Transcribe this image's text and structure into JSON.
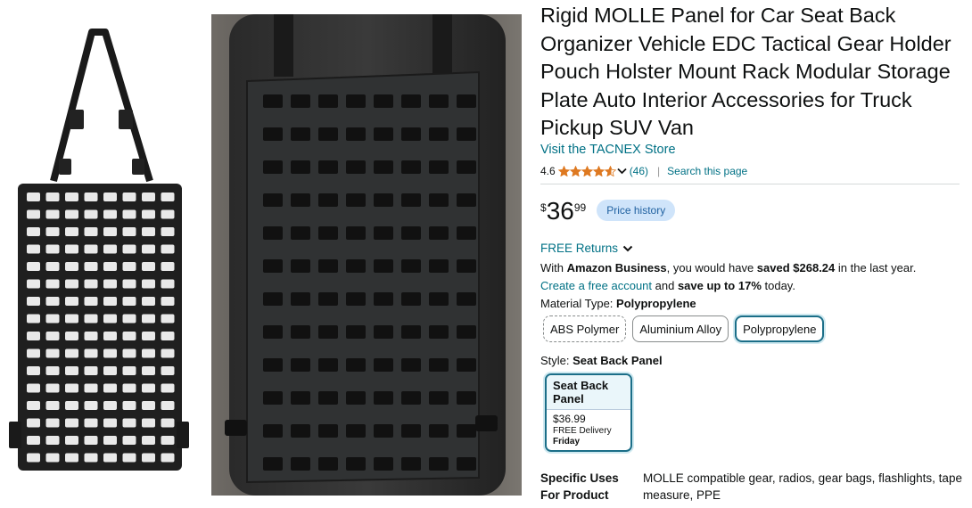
{
  "product": {
    "title": "Rigid MOLLE Panel for Car Seat Back Organizer Vehicle EDC Tactical Gear Holder Pouch Holster Mount Rack Modular Storage Plate Auto Interior Accessories for Truck Pickup SUV Van",
    "store_link": "Visit the TACNEX Store",
    "rating": "4.6",
    "rating_count": "(46)",
    "rating_value": 4.6,
    "search_page": "Search this page"
  },
  "price": {
    "currency": "$",
    "whole": "36",
    "fraction": "99",
    "history_label": "Price history"
  },
  "returns": {
    "label": "FREE Returns"
  },
  "business": {
    "prefix": "With ",
    "name": "Amazon Business",
    "middle": ", you would have ",
    "saved": "saved $268.24",
    "suffix": " in the last year."
  },
  "account": {
    "link": "Create a free account",
    "middle": " and ",
    "save": "save up to 17%",
    "suffix": " today."
  },
  "material": {
    "label": "Material Type: ",
    "selected": "Polypropylene",
    "options": [
      "ABS Polymer",
      "Aluminium Alloy",
      "Polypropylene"
    ]
  },
  "style": {
    "label": "Style: ",
    "selected": "Seat Back Panel",
    "card_title": "Seat Back Panel",
    "card_price": "$36.99",
    "card_delivery": "FREE Delivery",
    "card_day": "Friday"
  },
  "specs": {
    "label": "Specific Uses For Product",
    "value": "MOLLE compatible gear, radios, gear bags, flashlights, tape measure, PPE"
  },
  "icons": {
    "share": "share-icon",
    "star": "star-icon",
    "chevron": "chevron-down-icon"
  },
  "colors": {
    "link": "#007185",
    "star": "#de7921",
    "selected_border": "#1b6e88",
    "price_history_bg": "#cfe4fa"
  }
}
